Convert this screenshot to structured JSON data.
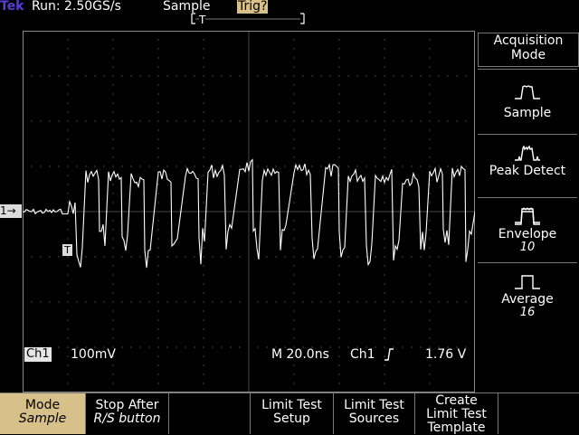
{
  "status": {
    "brand": "Tek",
    "run_state": "Run: 2.50GS/s",
    "acq_mode": "Sample",
    "trigger_state": "Trig?",
    "trigger_position_marker": "T"
  },
  "readouts": {
    "channel": "Ch1",
    "channel_scale": "100mV",
    "timebase": "M 20.0ns",
    "trigger_source": "Ch1",
    "trigger_level": "1.76 V"
  },
  "markers": {
    "ch1": "1→",
    "trigger_point": "T"
  },
  "side_menu": {
    "title": "Acquisition Mode",
    "items": [
      {
        "label": "Sample",
        "sub": "",
        "selected": true,
        "icon": "sample-waveform-icon"
      },
      {
        "label": "Peak Detect",
        "sub": "",
        "selected": false,
        "icon": "peak-detect-waveform-icon"
      },
      {
        "label": "Envelope",
        "sub": "10",
        "selected": false,
        "icon": "envelope-waveform-icon"
      },
      {
        "label": "Average",
        "sub": "16",
        "selected": false,
        "icon": "average-waveform-icon"
      }
    ]
  },
  "bottom_menu": [
    {
      "label": "Mode",
      "sub": "Sample",
      "selected": true
    },
    {
      "label": "Stop After",
      "sub": "R/S button",
      "selected": false
    },
    {
      "label": "",
      "sub": "",
      "selected": false
    },
    {
      "label": "Limit Test Setup",
      "sub": "",
      "selected": false
    },
    {
      "label": "Limit Test Sources",
      "sub": "",
      "selected": false
    },
    {
      "label": "Create Limit Test Template",
      "sub": "",
      "selected": false
    }
  ],
  "colors": {
    "background": "#000000",
    "trace": "#ffffff",
    "grid": "#8a8a8a",
    "selected_button": "#d8c08a",
    "brand": "#5a3fd6"
  }
}
